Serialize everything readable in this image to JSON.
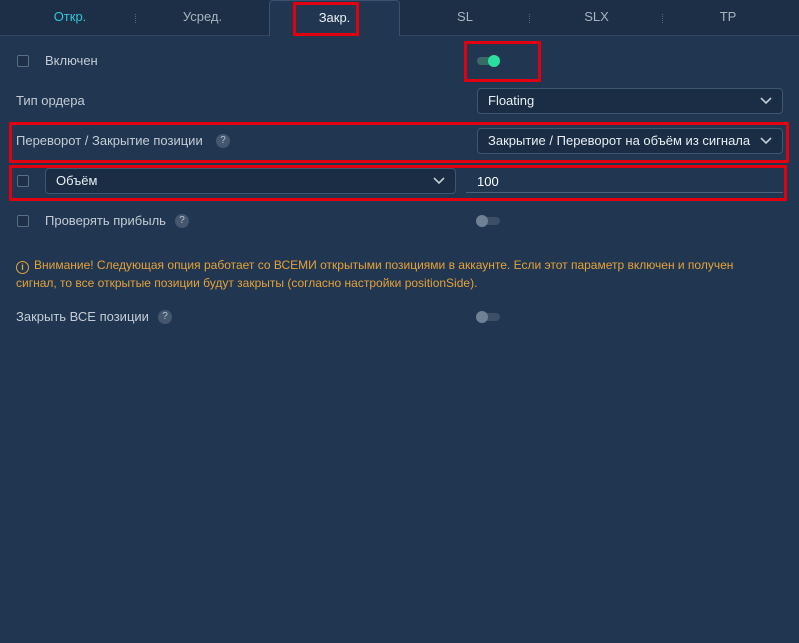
{
  "tabs": [
    {
      "label": "Откр."
    },
    {
      "label": "Усред."
    },
    {
      "label": "Закр."
    },
    {
      "label": "SL"
    },
    {
      "label": "SLX"
    },
    {
      "label": "TP"
    }
  ],
  "active_tab": "Закр.",
  "enabled": {
    "label": "Включен",
    "on": true
  },
  "order_type": {
    "label": "Тип ордера",
    "value": "Floating"
  },
  "reversal": {
    "label": "Переворот / Закрытие позиции",
    "help": "?",
    "value": "Закрытие / Переворот на объём из сигнала"
  },
  "volume": {
    "select_value": "Объём",
    "input_value": "100"
  },
  "check_profit": {
    "label": "Проверять прибыль",
    "help": "?",
    "on": false
  },
  "warning": {
    "icon": "i",
    "text": "Внимание! Следующая опция работает со ВСЕМИ открытыми позициями в аккаунте. Если этот параметр включен и получен сигнал, то все открытые позиции будут закрыты (согласно настройки positionSide)."
  },
  "close_all": {
    "label": "Закрыть ВСЕ позиции",
    "help": "?",
    "on": false
  },
  "colors": {
    "accent": "#35c6d8",
    "toggle_on": "#28e0a0",
    "warning": "#e4a23a",
    "highlight": "#e0000f",
    "background": "#213650"
  }
}
